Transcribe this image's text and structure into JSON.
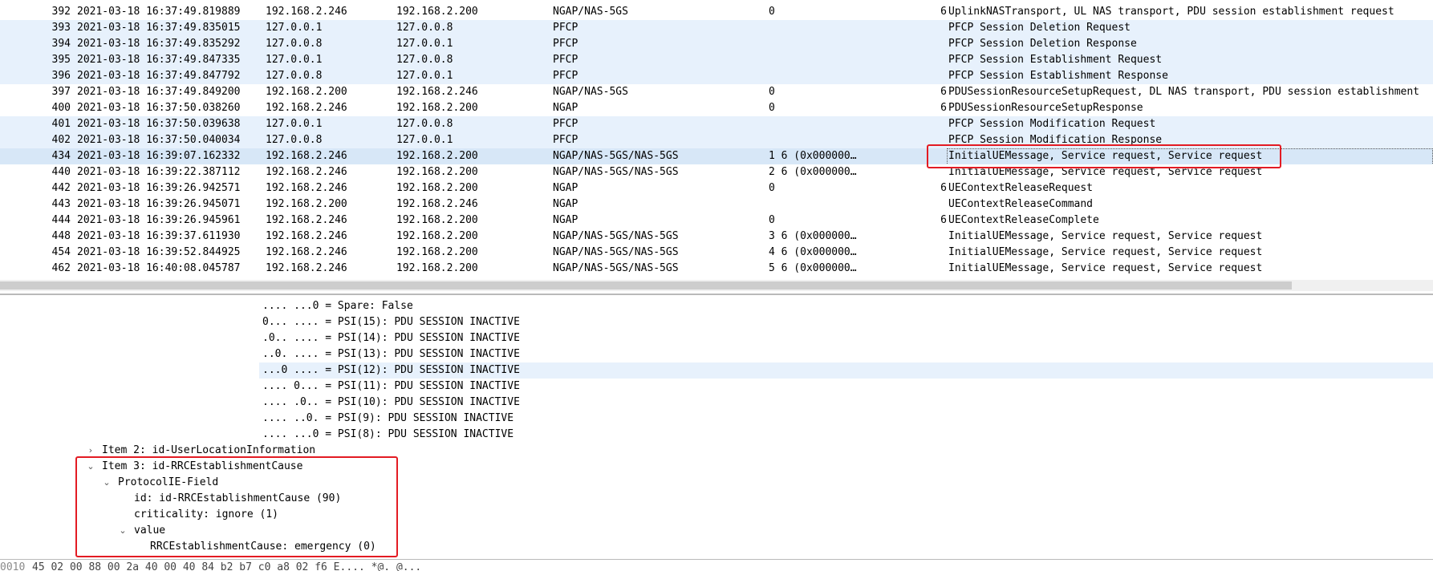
{
  "packet_list": {
    "rows": [
      {
        "no": "392",
        "time": "2021-03-18 16:37:49.819889",
        "src": "192.168.2.246",
        "dst": "192.168.2.200",
        "proto": "NGAP/NAS-5GS",
        "a": "0",
        "b": "6",
        "info": "UplinkNASTransport, UL NAS transport, PDU session establishment request"
      },
      {
        "no": "393",
        "time": "2021-03-18 16:37:49.835015",
        "src": "127.0.0.1",
        "dst": "127.0.0.8",
        "proto": "PFCP",
        "a": "",
        "b": "",
        "info": "PFCP Session Deletion Request"
      },
      {
        "no": "394",
        "time": "2021-03-18 16:37:49.835292",
        "src": "127.0.0.8",
        "dst": "127.0.0.1",
        "proto": "PFCP",
        "a": "",
        "b": "",
        "info": "PFCP Session Deletion Response"
      },
      {
        "no": "395",
        "time": "2021-03-18 16:37:49.847335",
        "src": "127.0.0.1",
        "dst": "127.0.0.8",
        "proto": "PFCP",
        "a": "",
        "b": "",
        "info": "PFCP Session Establishment Request"
      },
      {
        "no": "396",
        "time": "2021-03-18 16:37:49.847792",
        "src": "127.0.0.8",
        "dst": "127.0.0.1",
        "proto": "PFCP",
        "a": "",
        "b": "",
        "info": "PFCP Session Establishment Response"
      },
      {
        "no": "397",
        "time": "2021-03-18 16:37:49.849200",
        "src": "192.168.2.200",
        "dst": "192.168.2.246",
        "proto": "NGAP/NAS-5GS",
        "a": "0",
        "b": "6",
        "info": "PDUSessionResourceSetupRequest, DL NAS transport, PDU session establishment"
      },
      {
        "no": "400",
        "time": "2021-03-18 16:37:50.038260",
        "src": "192.168.2.246",
        "dst": "192.168.2.200",
        "proto": "NGAP",
        "a": "0",
        "b": "6",
        "info": "PDUSessionResourceSetupResponse"
      },
      {
        "no": "401",
        "time": "2021-03-18 16:37:50.039638",
        "src": "127.0.0.1",
        "dst": "127.0.0.8",
        "proto": "PFCP",
        "a": "",
        "b": "",
        "info": "PFCP Session Modification Request"
      },
      {
        "no": "402",
        "time": "2021-03-18 16:37:50.040034",
        "src": "127.0.0.8",
        "dst": "127.0.0.1",
        "proto": "PFCP",
        "a": "",
        "b": "",
        "info": "PFCP Session Modification Response"
      },
      {
        "no": "434",
        "time": "2021-03-18 16:39:07.162332",
        "src": "192.168.2.246",
        "dst": "192.168.2.200",
        "proto": "NGAP/NAS-5GS/NAS-5GS",
        "a": "1 6 (0x000000…",
        "b": "",
        "info": "InitialUEMessage, Service request, Service request"
      },
      {
        "no": "440",
        "time": "2021-03-18 16:39:22.387112",
        "src": "192.168.2.246",
        "dst": "192.168.2.200",
        "proto": "NGAP/NAS-5GS/NAS-5GS",
        "a": "2 6 (0x000000…",
        "b": "",
        "info": "InitialUEMessage, Service request, Service request"
      },
      {
        "no": "442",
        "time": "2021-03-18 16:39:26.942571",
        "src": "192.168.2.246",
        "dst": "192.168.2.200",
        "proto": "NGAP",
        "a": "0",
        "b": "6",
        "info": "UEContextReleaseRequest"
      },
      {
        "no": "443",
        "time": "2021-03-18 16:39:26.945071",
        "src": "192.168.2.200",
        "dst": "192.168.2.246",
        "proto": "NGAP",
        "a": "",
        "b": "",
        "info": "UEContextReleaseCommand"
      },
      {
        "no": "444",
        "time": "2021-03-18 16:39:26.945961",
        "src": "192.168.2.246",
        "dst": "192.168.2.200",
        "proto": "NGAP",
        "a": "0",
        "b": "6",
        "info": "UEContextReleaseComplete"
      },
      {
        "no": "448",
        "time": "2021-03-18 16:39:37.611930",
        "src": "192.168.2.246",
        "dst": "192.168.2.200",
        "proto": "NGAP/NAS-5GS/NAS-5GS",
        "a": "3 6 (0x000000…",
        "b": "",
        "info": "InitialUEMessage, Service request, Service request"
      },
      {
        "no": "454",
        "time": "2021-03-18 16:39:52.844925",
        "src": "192.168.2.246",
        "dst": "192.168.2.200",
        "proto": "NGAP/NAS-5GS/NAS-5GS",
        "a": "4 6 (0x000000…",
        "b": "",
        "info": "InitialUEMessage, Service request, Service request"
      },
      {
        "no": "462",
        "time": "2021-03-18 16:40:08.045787",
        "src": "192.168.2.246",
        "dst": "192.168.2.200",
        "proto": "NGAP/NAS-5GS/NAS-5GS",
        "a": "5 6 (0x000000…",
        "b": "",
        "info": "InitialUEMessage, Service request, Service request"
      }
    ]
  },
  "detail": {
    "bits": [
      ".... ...0 = Spare: False",
      "0... .... = PSI(15): PDU SESSION INACTIVE",
      ".0.. .... = PSI(14): PDU SESSION INACTIVE",
      "..0. .... = PSI(13): PDU SESSION INACTIVE",
      "...0 .... = PSI(12): PDU SESSION INACTIVE",
      ".... 0... = PSI(11): PDU SESSION INACTIVE",
      ".... .0.. = PSI(10): PDU SESSION INACTIVE",
      ".... ..0. = PSI(9): PDU SESSION INACTIVE",
      ".... ...0 = PSI(8): PDU SESSION INACTIVE"
    ],
    "item2": "Item 2: id-UserLocationInformation",
    "item3": "Item 3: id-RRCEstablishmentCause",
    "protocol_ie": "ProtocolIE-Field",
    "id_line": "id: id-RRCEstablishmentCause (90)",
    "criticality": "criticality: ignore (1)",
    "value": "value",
    "cause": "RRCEstablishmentCause: emergency (0)"
  },
  "bytes": {
    "offset": "0010",
    "hex": "45 02 00 88 00 2a 40 00  40 84 b2 b7 c0 a8 02 f6    E.... *@. @..."
  },
  "colors": {
    "pfcp_row": "#e7f1fc",
    "selected_row": "#d7e7f7",
    "annotation": "#e31b23"
  }
}
